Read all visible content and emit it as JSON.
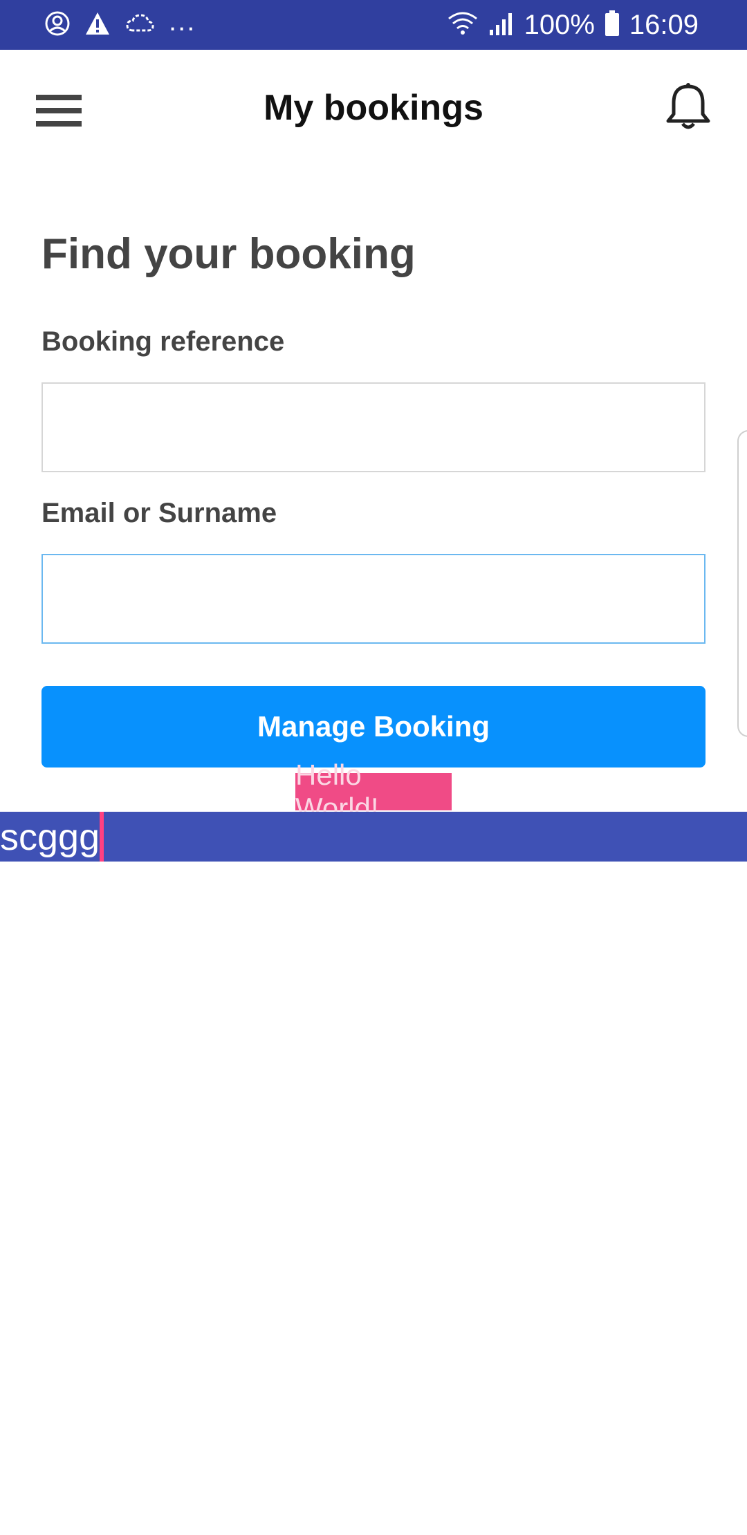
{
  "status_bar": {
    "left_icons": [
      "account-circle-icon",
      "warning-icon",
      "cloud-sync-icon"
    ],
    "more_indicator": "...",
    "battery": "100%",
    "time": "16:09",
    "right_icons": [
      "wifi-icon",
      "cellular-signal-icon",
      "battery-icon"
    ],
    "background_color": "#303f9f"
  },
  "app_bar": {
    "title": "My bookings",
    "menu_icon": "hamburger-menu-icon",
    "notifications_icon": "bell-icon"
  },
  "form": {
    "heading": "Find your booking",
    "booking_reference": {
      "label": "Booking reference",
      "value": ""
    },
    "email_or_surname": {
      "label": "Email or Surname",
      "value": "",
      "focused": true
    },
    "submit_label": "Manage Booking",
    "accent_color": "#0891fd"
  },
  "toast": {
    "text": "Hello World!",
    "color": "#f04b86"
  },
  "overlay_bar": {
    "text": "scggg",
    "color": "#3f51b5",
    "cursor_color": "#ff4081"
  }
}
